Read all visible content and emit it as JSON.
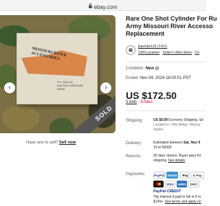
{
  "browser": {
    "url": "ebay.com"
  },
  "gallery": {
    "box_label": "Missouri River Accessories",
    "box_address": [
      "P.O. BOX 45",
      "PAXTON, MISSOURI",
      "63033"
    ],
    "sold_label": "SOLD",
    "prev_icon": "chevron-left-icon",
    "next_icon": "chevron-right-icon"
  },
  "sell": {
    "prompt": "Have one to sell?",
    "link": "Sell now"
  },
  "listing": {
    "title_lines": [
      "Rare One Shot Cylinder For Ru",
      "Army Missouri River Accesso",
      "Replacement"
    ],
    "seller": {
      "name": "jlaschke123",
      "feedback_count": "(5454)",
      "positive": "100% positive",
      "links": "Seller's other items",
      "contact": "Co"
    },
    "condition": {
      "label": "Condition:",
      "value": "New"
    },
    "ended": {
      "label": "Ended:",
      "value": "Nov 04, 2024 18:00:01 PST"
    },
    "price": "US $172.50",
    "bids": {
      "count": "5 bids",
      "separator": "·",
      "status": "Ended"
    }
  },
  "shipping": {
    "label": "Shipping:",
    "line1_bold": "US $9.99",
    "line1_rest": "Economy Shipping. Se",
    "line2": "Located in: Villa Ridge, Missou",
    "line3": "States"
  },
  "delivery": {
    "label": "Delivery:",
    "line1_prefix": "Estimated between",
    "line1_bold": "Sat, Nov 9",
    "line2": "15 to 56003"
  },
  "returns": {
    "label": "Returns:",
    "line1": "30 days returns. Buyer pays for",
    "line2_prefix": "shipping.",
    "line2_link": "See details"
  },
  "payments": {
    "label": "Payments:",
    "methods": [
      "PayPal",
      "Venmo",
      "Pay",
      "G Pay",
      "MC",
      "VISA",
      "AMEX",
      "DISC"
    ],
    "credit": "PayPal CREDIT",
    "note1": "*No Interest if paid in full in 6 m",
    "note2_prefix": "$149+.",
    "note2_link": "See terms and apply no"
  },
  "colors": {
    "accent": "#191919",
    "ended_red": "#e0103a",
    "paypal_blue": "#003087",
    "paypal_light": "#009cde",
    "venmo_blue": "#3d95ce"
  }
}
